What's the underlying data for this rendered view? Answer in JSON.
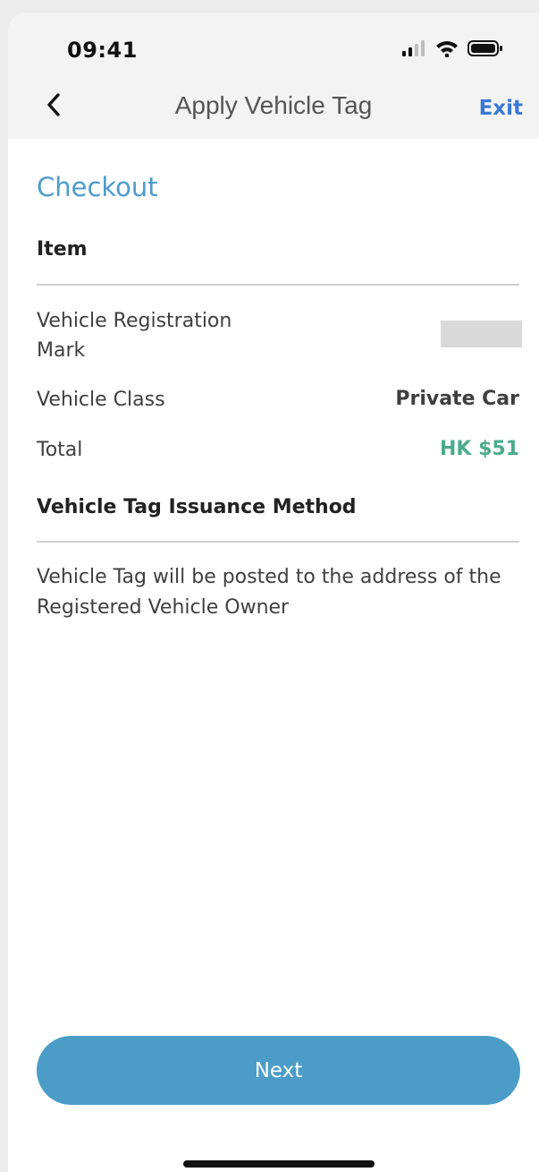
{
  "status_bar": {
    "time": "09:41",
    "icons": [
      "signal-icon",
      "wifi-icon",
      "battery-icon"
    ]
  },
  "nav": {
    "back_icon": "chevron-left-icon",
    "title": "Apply Vehicle Tag",
    "exit_label": "Exit"
  },
  "checkout": {
    "title": "Checkout",
    "item_heading": "Item",
    "rows": [
      {
        "label": "Vehicle Registration Mark",
        "value": ""
      },
      {
        "label": "Vehicle Class",
        "value": "Private Car"
      },
      {
        "label": "Total",
        "value": "HK $51"
      }
    ],
    "issuance_heading": "Vehicle Tag Issuance Method",
    "issuance_text": "Vehicle Tag will be posted to the address of the Registered Vehicle Owner"
  },
  "actions": {
    "next_label": "Next"
  },
  "colors": {
    "accent": "#4d9ccd",
    "button": "#4b9dc8",
    "link": "#3a78d6",
    "total": "#4bab8c"
  }
}
